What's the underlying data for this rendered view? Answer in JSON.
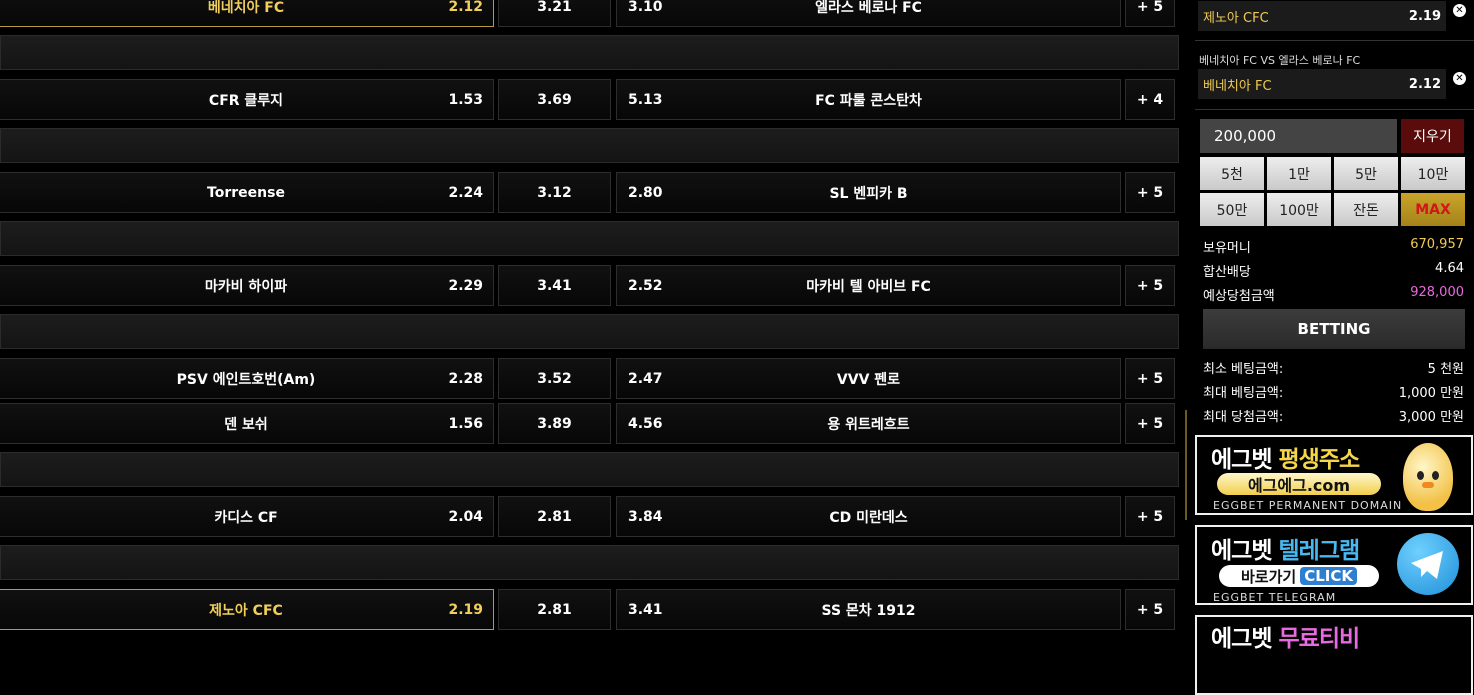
{
  "matches": [
    {
      "home": "베네치아 FC",
      "home_odds": "2.12",
      "draw": "3.21",
      "away_odds": "3.10",
      "away": "엘라스 베로나 FC",
      "more": "+ 5",
      "home_selected": true
    },
    {
      "home": "CFR 클루지",
      "home_odds": "1.53",
      "draw": "3.69",
      "away_odds": "5.13",
      "away": "FC 파룰 콘스탄차",
      "more": "+ 4",
      "home_selected": false
    },
    {
      "home": "Torreense",
      "home_odds": "2.24",
      "draw": "3.12",
      "away_odds": "2.80",
      "away": "SL 벤피카 B",
      "more": "+ 5",
      "home_selected": false
    },
    {
      "home": "마카비 하이파",
      "home_odds": "2.29",
      "draw": "3.41",
      "away_odds": "2.52",
      "away": "마카비 텔 아비브 FC",
      "more": "+ 5",
      "home_selected": false
    },
    {
      "home": "PSV 에인트호번(Am)",
      "home_odds": "2.28",
      "draw": "3.52",
      "away_odds": "2.47",
      "away": "VVV 펜로",
      "more": "+ 5",
      "home_selected": false
    },
    {
      "home": "덴 보쉬",
      "home_odds": "1.56",
      "draw": "3.89",
      "away_odds": "4.56",
      "away": "용 위트레흐트",
      "more": "+ 5",
      "home_selected": false
    },
    {
      "home": "카디스 CF",
      "home_odds": "2.04",
      "draw": "2.81",
      "away_odds": "3.84",
      "away": "CD 미란데스",
      "more": "+ 5",
      "home_selected": false
    },
    {
      "home": "제노아 CFC",
      "home_odds": "2.19",
      "draw": "2.81",
      "away_odds": "3.41",
      "away": "SS 몬차 1912",
      "more": "+ 5",
      "home_selected": true
    }
  ],
  "betslip": {
    "items": [
      {
        "team": "제노아 CFC",
        "odds": "2.19"
      },
      {
        "match": "베네치아 FC VS 엘라스 베로나 FC",
        "team": "베네치아 FC",
        "odds": "2.12"
      }
    ],
    "remove_icon": "✕",
    "amount": "200,000",
    "clear_label": "지우기",
    "chips": [
      "5천",
      "1만",
      "5만",
      "10만",
      "50만",
      "100만",
      "잔돈",
      "MAX"
    ],
    "balance_label": "보유머니",
    "balance": "670,957",
    "total_odds_label": "합산배당",
    "total_odds": "4.64",
    "expected_label": "예상당첨금액",
    "expected": "928,000",
    "betting_label": "BETTING",
    "min_bet_label": "최소 베팅금액:",
    "min_bet": "5 천원",
    "max_bet_label": "최대 베팅금액:",
    "max_bet": "1,000 만원",
    "max_win_label": "최대 당첨금액:",
    "max_win": "3,000 만원"
  },
  "banners": {
    "domain": {
      "title_a": "에그벳",
      "title_b": "평생주소",
      "pill": "에그에그.com",
      "sub": "EGGBET PERMANENT DOMAIN"
    },
    "telegram": {
      "title_a": "에그벳",
      "title_b": "텔레그램",
      "pill_a": "바로가기",
      "pill_b": "CLICK",
      "sub": "EGGBET TELEGRAM"
    },
    "tv": {
      "title_a": "에그벳",
      "title_b": "무료티비"
    }
  },
  "colors": {
    "highlight": "#f1cf5a",
    "expected": "#e86ae0",
    "balance": "#f0cb52",
    "clear": "#5a0c0c"
  }
}
